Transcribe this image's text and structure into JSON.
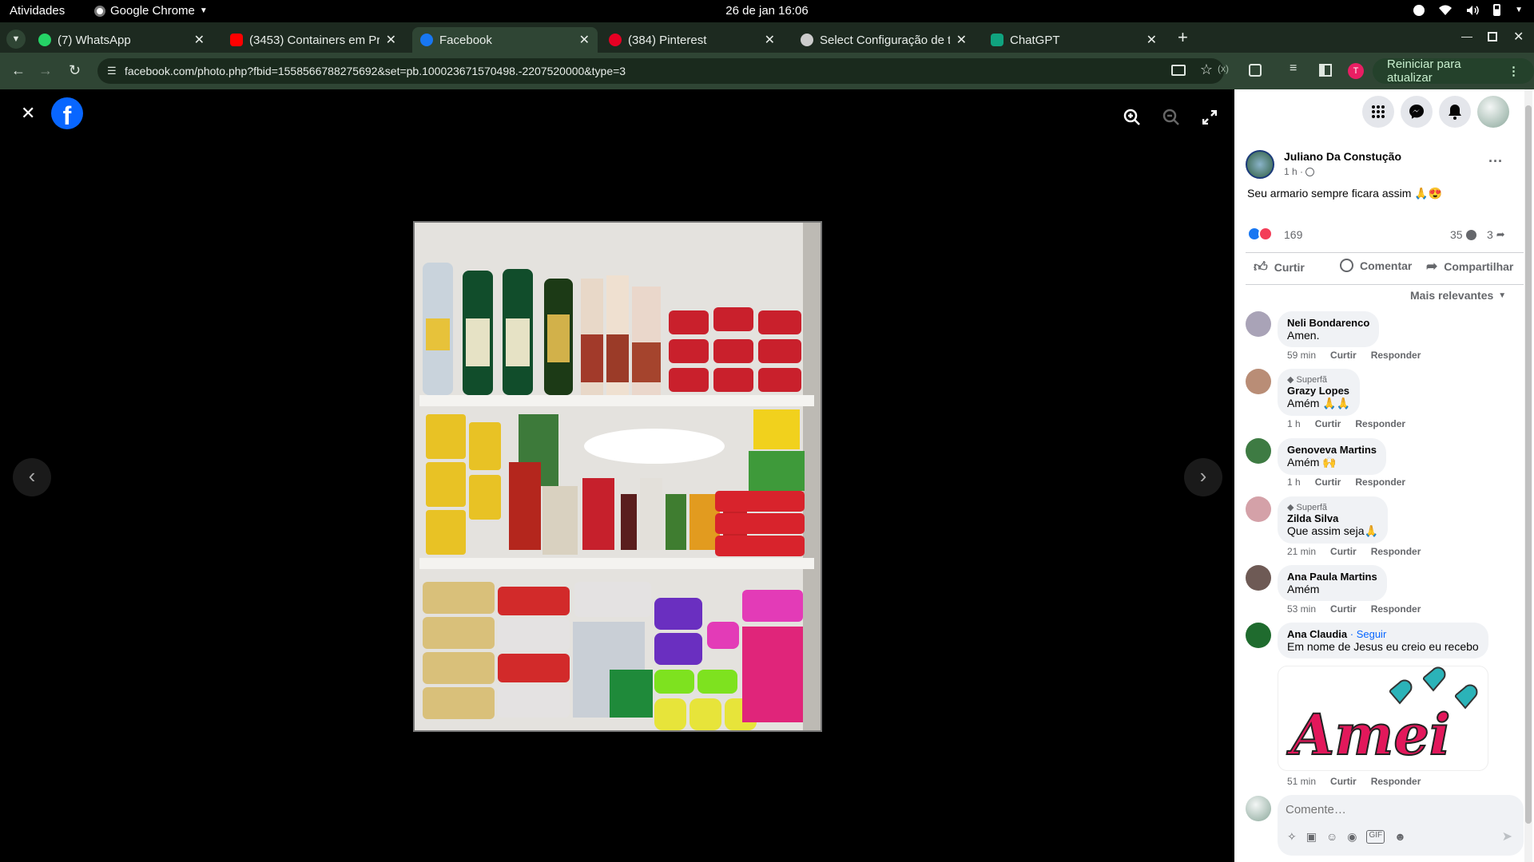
{
  "system": {
    "activities": "Atividades",
    "app_name": "Google Chrome",
    "clock": "26 de jan  16:06"
  },
  "tabs": [
    {
      "title": "(7) WhatsApp",
      "favicon_color": "#25d366"
    },
    {
      "title": "(3453) Containers em Pr",
      "favicon_color": "#ff0000"
    },
    {
      "title": "Facebook",
      "favicon_color": "#1877f2"
    },
    {
      "title": "(384) Pinterest",
      "favicon_color": "#e60023"
    },
    {
      "title": "Select Configuração de t",
      "favicon_color": "#cccccc"
    },
    {
      "title": "ChatGPT",
      "favicon_color": "#10a37f"
    }
  ],
  "new_tab": "+",
  "address": {
    "url": "facebook.com/photo.php?fbid=1558566788275692&set=pb.100023671570498.-2207520000&type=3",
    "update_label": "Reiniciar para atualizar",
    "profile_initial": "T"
  },
  "viewer": {
    "close": "✕"
  },
  "post": {
    "author": "Juliano Da Constução",
    "time": "1 h · ",
    "text": "Seu armario sempre ficara assim 🙏😍",
    "reactions": "169",
    "comments_count": "35",
    "shares_count": "3",
    "like": "Curtir",
    "comment": "Comentar",
    "share": "Compartilhar",
    "sort": "Mais relevantes"
  },
  "comments": [
    {
      "name": "Neli Bondarenco",
      "badge": "",
      "text": "Amen.",
      "time": "59 min",
      "avatar": "#a9a3b7"
    },
    {
      "name": "Grazy Lopes",
      "badge": "Superfã",
      "text": "Amém 🙏🙏",
      "time": "1 h",
      "avatar": "#b98d76"
    },
    {
      "name": "Genoveva Martins",
      "badge": "",
      "text": "Amém 🙌",
      "time": "1 h",
      "avatar": "#3e7b43"
    },
    {
      "name": "Zilda Silva",
      "badge": "Superfã",
      "text": "Que assim seja🙏",
      "time": "21 min",
      "avatar": "#d4a1a8"
    },
    {
      "name": "Ana Paula Martins",
      "badge": "",
      "text": "Amém",
      "time": "53 min",
      "avatar": "#6e5a55"
    },
    {
      "name": "Ana Claudia",
      "badge": "",
      "text": "Em nome de Jesus eu creio eu recebo",
      "time": "51 min",
      "avatar": "#1f6b2e",
      "follow": "· Seguir",
      "sticker": "Amei"
    }
  ],
  "comment_actions": {
    "like": "Curtir",
    "reply": "Responder"
  },
  "composer": {
    "placeholder": "Comente…"
  }
}
